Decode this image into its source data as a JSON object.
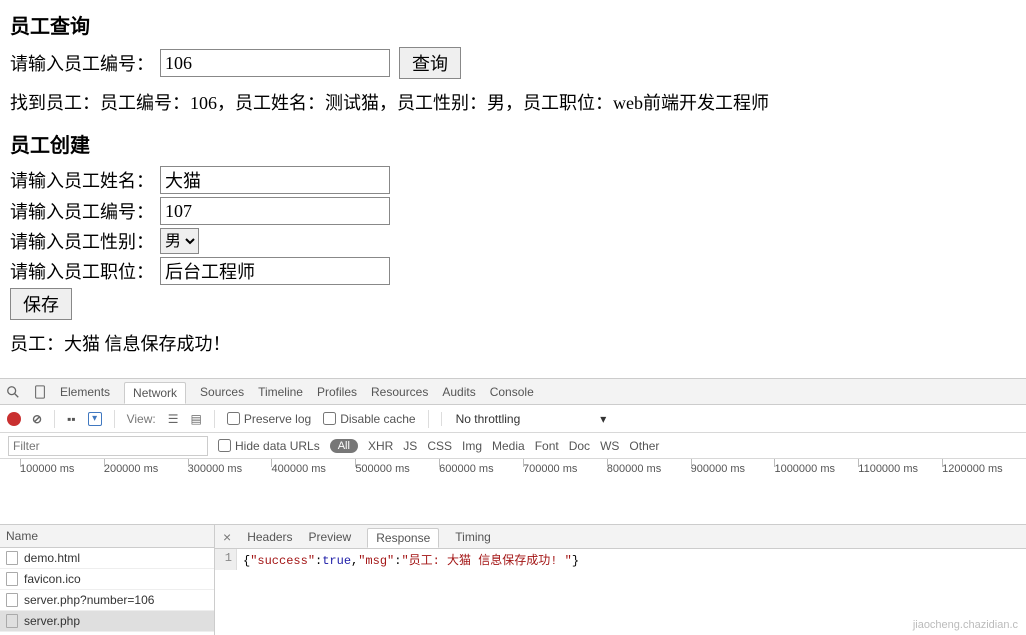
{
  "query": {
    "heading": "员工查询",
    "label_number": "请输入员工编号：",
    "number_value": "106",
    "button": "查询",
    "result": "找到员工：员工编号：106，员工姓名：测试猫，员工性别：男，员工职位：web前端开发工程师"
  },
  "create": {
    "heading": "员工创建",
    "label_name": "请输入员工姓名：",
    "name_value": "大猫",
    "label_number": "请输入员工编号：",
    "number_value": "107",
    "label_gender": "请输入员工性别：",
    "gender_value": "男",
    "label_job": "请输入员工职位：",
    "job_value": "后台工程师",
    "save_button": "保存",
    "result": "员工：大猫 信息保存成功！"
  },
  "devtools": {
    "tabs": [
      "Elements",
      "Network",
      "Sources",
      "Timeline",
      "Profiles",
      "Resources",
      "Audits",
      "Console"
    ],
    "active_tab": "Network",
    "toolbar": {
      "view_label": "View:",
      "preserve_log": "Preserve log",
      "disable_cache": "Disable cache",
      "throttling": "No throttling"
    },
    "filter": {
      "placeholder": "Filter",
      "hide_data_urls": "Hide data URLs",
      "all": "All",
      "types": [
        "XHR",
        "JS",
        "CSS",
        "Img",
        "Media",
        "Font",
        "Doc",
        "WS",
        "Other"
      ]
    },
    "timeline_marks": [
      "100000 ms",
      "200000 ms",
      "300000 ms",
      "400000 ms",
      "500000 ms",
      "600000 ms",
      "700000 ms",
      "800000 ms",
      "900000 ms",
      "1000000 ms",
      "1100000 ms",
      "1200000 ms"
    ],
    "network": {
      "name_header": "Name",
      "items": [
        "demo.html",
        "favicon.ico",
        "server.php?number=106",
        "server.php"
      ],
      "selected_index": 3
    },
    "detail": {
      "tabs": [
        "Headers",
        "Preview",
        "Response",
        "Timing"
      ],
      "active_tab": "Response",
      "response_line_no": "1",
      "response_json": {
        "raw_display": "{\"success\":true,\"msg\":\"员工: 大猫 信息保存成功! \"}",
        "k_success": "\"success\"",
        "v_true": "true",
        "k_msg": "\"msg\"",
        "v_msg": "\"员工: 大猫 信息保存成功! \""
      }
    }
  },
  "watermark": "jiaocheng.chazidian.c"
}
